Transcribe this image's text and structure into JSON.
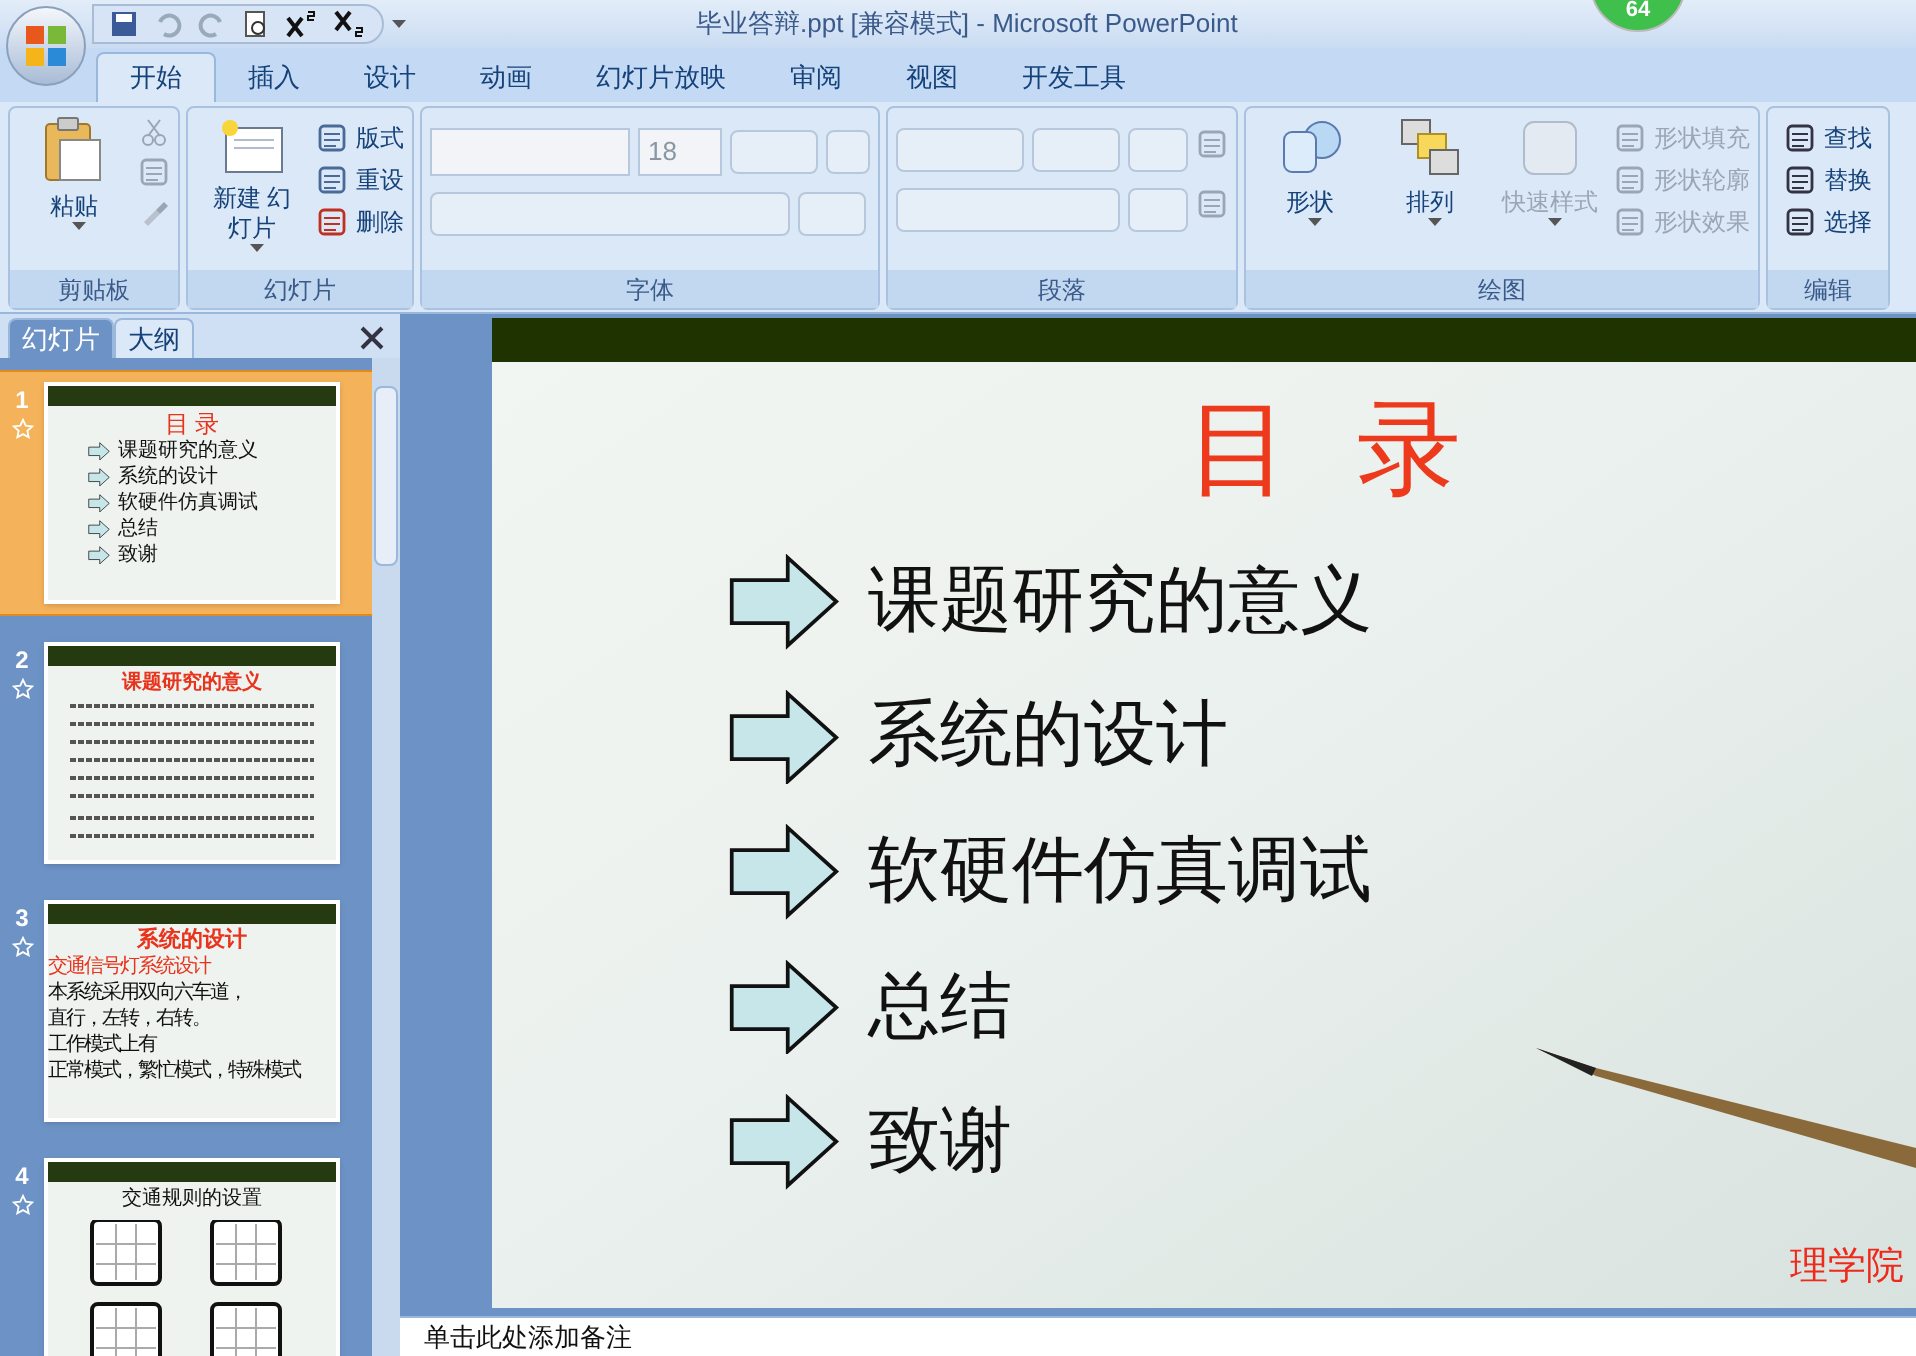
{
  "title_bar": {
    "title": "毕业答辩.ppt [兼容模式] - Microsoft PowerPoint",
    "badge": "64"
  },
  "tabs": [
    {
      "label": "开始",
      "selected": true
    },
    {
      "label": "插入",
      "selected": false
    },
    {
      "label": "设计",
      "selected": false
    },
    {
      "label": "动画",
      "selected": false
    },
    {
      "label": "幻灯片放映",
      "selected": false
    },
    {
      "label": "审阅",
      "selected": false
    },
    {
      "label": "视图",
      "selected": false
    },
    {
      "label": "开发工具",
      "selected": false
    }
  ],
  "ribbon_groups": [
    {
      "kind": "clipboard",
      "label": "剪贴板",
      "large": [
        {
          "label": "粘贴",
          "disabled": false
        }
      ]
    },
    {
      "kind": "slides",
      "label": "幻灯片",
      "large": [
        {
          "label": "新建 幻灯片",
          "disabled": false
        }
      ],
      "small": [
        {
          "label": "版式",
          "disabled": false
        },
        {
          "label": "重设",
          "disabled": false
        },
        {
          "label": "删除",
          "disabled": false
        }
      ]
    },
    {
      "kind": "font",
      "label": "字体",
      "font_size": "18"
    },
    {
      "kind": "paragraph",
      "label": "段落"
    },
    {
      "kind": "drawing",
      "label": "绘图",
      "large": [
        {
          "label": "形状",
          "disabled": false
        },
        {
          "label": "排列",
          "disabled": false
        },
        {
          "label": "快速样式",
          "disabled": true
        }
      ],
      "small": [
        {
          "label": "形状填充",
          "disabled": true
        },
        {
          "label": "形状轮廓",
          "disabled": true
        },
        {
          "label": "形状效果",
          "disabled": true
        }
      ]
    },
    {
      "kind": "editing",
      "label": "编辑",
      "small": [
        {
          "label": "查找",
          "disabled": false
        },
        {
          "label": "替换",
          "disabled": false
        },
        {
          "label": "选择",
          "disabled": false
        }
      ]
    }
  ],
  "panel_tabs": [
    {
      "label": "幻灯片",
      "selected": true
    },
    {
      "label": "大纲",
      "selected": false
    }
  ],
  "thumbnails": [
    {
      "number": "1",
      "selected": true,
      "kind": "toc",
      "title": "目 录",
      "items": [
        "课题研究的意义",
        "系统的设计",
        "软硬件仿真调试",
        "总结",
        "致谢"
      ]
    },
    {
      "number": "2",
      "selected": false,
      "kind": "text",
      "title": "课题研究的意义"
    },
    {
      "number": "3",
      "selected": false,
      "kind": "list",
      "title": "系统的设计",
      "items": [
        "交通信号灯系统设计",
        "本系统采用双向六车道，",
        "直行，左转，右转。",
        "工作模式上有",
        "正常模式，繁忙模式，特殊模式"
      ]
    },
    {
      "number": "4",
      "selected": false,
      "kind": "diagram",
      "title": "交通规则的设置"
    }
  ],
  "slide": {
    "title": "目  录",
    "items": [
      "课题研究的意义",
      "系统的设计",
      "软硬件仿真调试",
      "总结",
      "致谢"
    ],
    "footer": "理学院"
  },
  "notes": {
    "placeholder": "单击此处添加备注"
  }
}
